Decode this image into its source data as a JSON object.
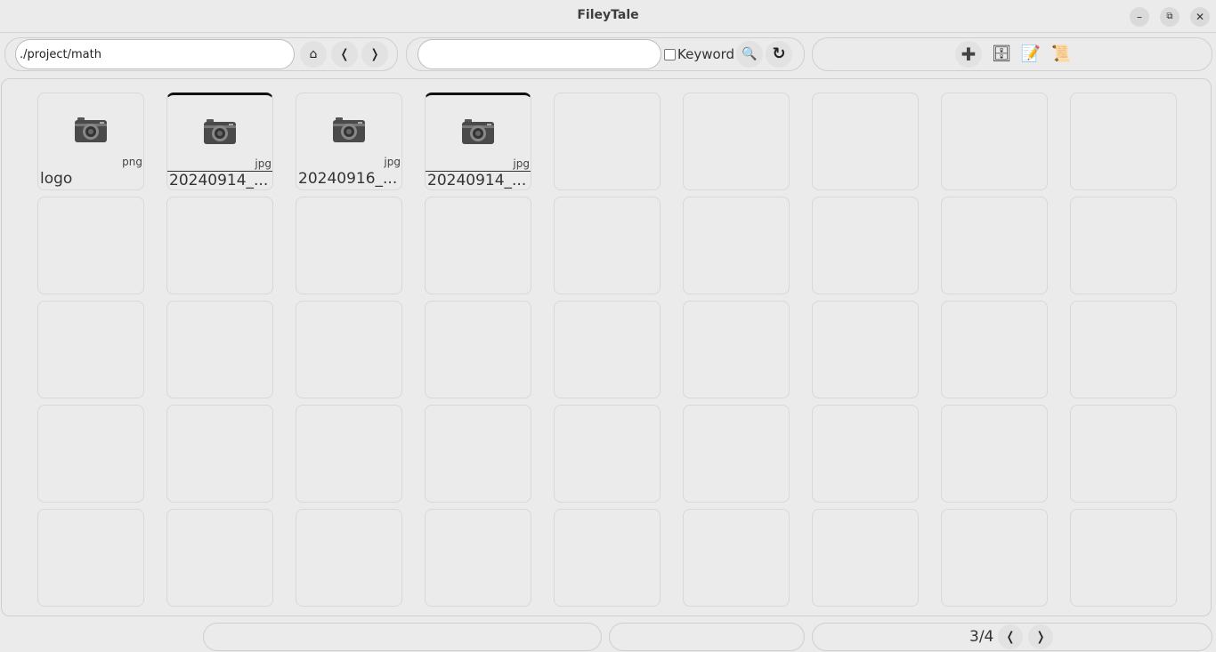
{
  "window": {
    "title": "FileyTale",
    "minimize_label": "–",
    "restore_label": "⧉",
    "close_label": "✕"
  },
  "toolbar": {
    "path_value": "./project/math",
    "home_icon": "⌂",
    "back_icon": "❬",
    "forward_icon": "❭",
    "search_value": "",
    "keyword_label": "Keyword",
    "search_icon": "🔍",
    "refresh_icon": "↻",
    "add_icon": "✚",
    "cabinet_icon": "🗄",
    "memo_icon": "📝",
    "scroll_icon": "📜"
  },
  "files": [
    {
      "name": "logo",
      "ext": "png",
      "selected": false
    },
    {
      "name": "20240914_...",
      "ext": "jpg",
      "selected": true
    },
    {
      "name": "20240916_...",
      "ext": "jpg",
      "selected": false
    },
    {
      "name": "20240914_...",
      "ext": "jpg",
      "selected": true
    }
  ],
  "footer": {
    "page_indicator": "3/4",
    "prev_icon": "❬",
    "next_icon": "❭"
  }
}
